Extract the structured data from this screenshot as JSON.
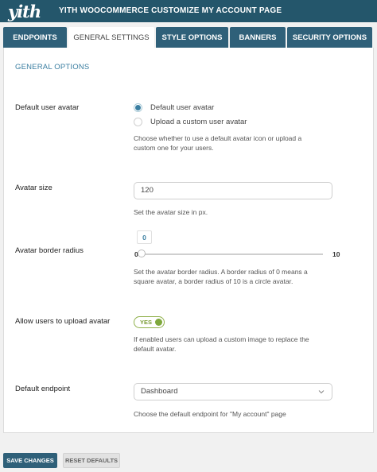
{
  "header": {
    "logo_text": "yith",
    "title": "YITH WOOCOMMERCE CUSTOMIZE MY ACCOUNT PAGE"
  },
  "tabs": [
    {
      "label": "ENDPOINTS",
      "active": false
    },
    {
      "label": "GENERAL SETTINGS",
      "active": true
    },
    {
      "label": "STYLE OPTIONS",
      "active": false
    },
    {
      "label": "BANNERS",
      "active": false
    },
    {
      "label": "SECURITY OPTIONS",
      "active": false
    }
  ],
  "panel": {
    "section_title": "GENERAL OPTIONS",
    "default_avatar": {
      "label": "Default user avatar",
      "options": [
        "Default user avatar",
        "Upload a custom user avatar"
      ],
      "selected": "Default user avatar",
      "description": "Choose whether to use a default avatar icon or upload a custom one for your users."
    },
    "avatar_size": {
      "label": "Avatar size",
      "value": "120",
      "description": "Set the avatar size in px."
    },
    "border_radius": {
      "label": "Avatar border radius",
      "value": "0",
      "value_number": 0,
      "min_label": "0",
      "max_label": "10",
      "min": 0,
      "max": 10,
      "description": "Set the avatar border radius. A border radius of 0 means a square avatar, a border radius of 10 is a circle avatar."
    },
    "allow_upload": {
      "label": "Allow users to upload avatar",
      "toggle_label": "YES",
      "enabled": true,
      "description": "If enabled users can upload a custom image to replace the default avatar."
    },
    "default_endpoint": {
      "label": "Default endpoint",
      "selected": "Dashboard",
      "description": "Choose the default endpoint for \"My account\" page"
    }
  },
  "footer": {
    "save_label": "SAVE CHANGES",
    "reset_label": "RESET DEFAULTS"
  },
  "colors": {
    "header_bg": "#24566b",
    "tab_bg": "#2f6079",
    "accent": "#3a7ea1",
    "toggle_green": "#7ea83c"
  }
}
